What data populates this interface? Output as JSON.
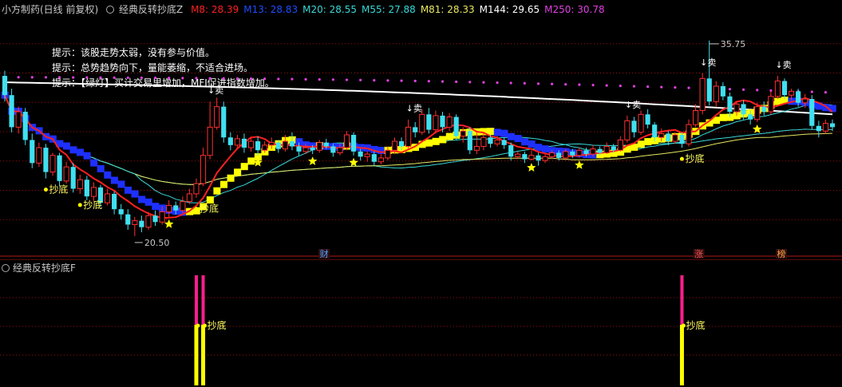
{
  "header": {
    "stock_name": "小方制药(日线 前复权)",
    "indicator_name": "经典反转抄底Z",
    "ma_labels": [
      {
        "text": "M8: 28.39",
        "color": "#ff2020"
      },
      {
        "text": "M13: 28.83",
        "color": "#1e4cff"
      },
      {
        "text": "M20: 28.55",
        "color": "#38d8d8"
      },
      {
        "text": "M55: 27.88",
        "color": "#38d8d8"
      },
      {
        "text": "M81: 28.33",
        "color": "#e8e860"
      },
      {
        "text": "M144: 29.65",
        "color": "#ffffff"
      },
      {
        "text": "M250: 30.78",
        "color": "#e040e0"
      }
    ]
  },
  "tips": [
    "提示：该股走势太弱，没有参与价值。",
    "提示：总势趋势向下，量能萎缩，不适合进场。",
    "提示：【绿灯】买计交易里增加，MFI促进指数增加。"
  ],
  "sub_header": {
    "indicator_name": "经典反转抄底F"
  },
  "colors": {
    "up": "#ff3030",
    "down": "#40e0f0",
    "m8": "#ff2020",
    "m20": "#38d8d8",
    "m81": "#e8e860",
    "m144": "#ffffff",
    "m250": "#e040e0",
    "band_yellow": "#ffff00",
    "band_blue": "#1e30ff",
    "label": "#ffff60",
    "bar_magenta": "#ff1e8c",
    "bar_yellow": "#ffff00",
    "grid": "#a01010",
    "axis": "#b01818"
  },
  "chart_data": {
    "type": "candlestick",
    "price_range": [
      19.5,
      37.8
    ],
    "max_price": {
      "label": "35.75"
    },
    "min_price": {
      "label": "20.50"
    },
    "signals": {
      "buy_label": "抄底",
      "sell_label": "卖",
      "sub_buy_label": "抄底"
    },
    "markers": [
      {
        "label": "财",
        "color": "#4aa0ff"
      },
      {
        "label": "涨",
        "color": "#ff5050"
      },
      {
        "label": "榜",
        "color": "#ffa040"
      }
    ],
    "candles": [
      [
        33.0,
        31.5,
        33.4,
        31.0
      ],
      [
        31.5,
        29.0,
        32.0,
        28.6
      ],
      [
        29.0,
        30.2,
        30.6,
        28.5
      ],
      [
        30.2,
        28.0,
        30.5,
        27.6
      ],
      [
        28.0,
        26.2,
        28.5,
        25.8
      ],
      [
        26.2,
        27.4,
        27.8,
        25.9
      ],
      [
        27.4,
        25.5,
        27.7,
        25.0
      ],
      [
        25.5,
        26.8,
        27.0,
        25.2
      ],
      [
        26.8,
        24.8,
        27.0,
        24.4
      ],
      [
        24.8,
        25.9,
        26.3,
        24.6
      ],
      [
        25.9,
        24.2,
        26.2,
        23.9
      ],
      [
        24.2,
        24.9,
        25.3,
        23.8
      ],
      [
        24.9,
        23.6,
        25.2,
        23.3
      ],
      [
        23.6,
        24.3,
        24.7,
        23.2
      ],
      [
        24.3,
        23.1,
        24.5,
        22.8
      ],
      [
        23.1,
        23.8,
        24.2,
        22.9
      ],
      [
        23.8,
        22.6,
        24.0,
        22.2
      ],
      [
        22.6,
        22.2,
        23.0,
        21.8
      ],
      [
        22.2,
        21.4,
        22.6,
        21.0
      ],
      [
        21.4,
        21.7,
        22.0,
        20.5
      ],
      [
        21.7,
        21.2,
        22.1,
        20.8
      ],
      [
        21.2,
        22.1,
        22.4,
        21.0
      ],
      [
        22.1,
        21.6,
        22.5,
        21.3
      ],
      [
        21.6,
        22.4,
        22.8,
        21.4
      ],
      [
        22.4,
        22.9,
        23.3,
        22.0
      ],
      [
        22.9,
        22.5,
        23.2,
        22.2
      ],
      [
        22.5,
        23.2,
        23.6,
        22.3
      ],
      [
        23.2,
        23.8,
        24.2,
        23.0
      ],
      [
        23.8,
        24.6,
        25.0,
        23.5
      ],
      [
        24.6,
        26.8,
        27.4,
        24.4
      ],
      [
        26.8,
        29.0,
        31.0,
        26.5
      ],
      [
        29.0,
        30.6,
        31.3,
        28.8
      ],
      [
        30.6,
        28.2,
        31.0,
        27.8
      ],
      [
        28.2,
        27.6,
        28.6,
        27.2
      ],
      [
        27.6,
        28.1,
        28.4,
        27.3
      ],
      [
        28.1,
        27.4,
        28.5,
        27.0
      ],
      [
        27.4,
        27.9,
        28.2,
        27.1
      ],
      [
        27.9,
        27.2,
        28.3,
        26.8
      ],
      [
        27.2,
        27.6,
        27.9,
        27.0
      ],
      [
        27.6,
        27.8,
        28.2,
        27.3
      ],
      [
        27.8,
        27.3,
        28.0,
        27.0
      ],
      [
        27.3,
        27.9,
        28.4,
        27.1
      ],
      [
        27.9,
        27.5,
        28.6,
        27.2
      ],
      [
        27.5,
        27.1,
        27.8,
        26.8
      ],
      [
        27.1,
        27.4,
        27.7,
        26.9
      ],
      [
        27.4,
        27.2,
        27.6,
        26.9
      ],
      [
        27.2,
        27.8,
        28.0,
        27.0
      ],
      [
        27.8,
        27.5,
        28.1,
        27.3
      ],
      [
        27.5,
        27.0,
        27.7,
        26.7
      ],
      [
        27.0,
        27.4,
        27.7,
        26.8
      ],
      [
        27.4,
        28.4,
        28.7,
        27.2
      ],
      [
        28.4,
        27.1,
        28.6,
        26.8
      ],
      [
        27.1,
        26.7,
        27.3,
        26.4
      ],
      [
        26.7,
        26.9,
        27.1,
        26.3
      ],
      [
        26.9,
        26.3,
        27.1,
        26.0
      ],
      [
        26.3,
        26.6,
        26.9,
        26.1
      ],
      [
        26.6,
        27.2,
        27.5,
        26.4
      ],
      [
        27.2,
        27.9,
        28.2,
        26.9
      ],
      [
        27.9,
        27.5,
        28.2,
        27.2
      ],
      [
        27.5,
        29.0,
        29.6,
        27.3
      ],
      [
        29.0,
        28.6,
        29.4,
        28.2
      ],
      [
        28.6,
        30.0,
        30.4,
        28.4
      ],
      [
        30.0,
        28.8,
        30.5,
        28.5
      ],
      [
        28.8,
        29.9,
        30.3,
        28.5
      ],
      [
        29.9,
        29.0,
        30.2,
        28.6
      ],
      [
        29.0,
        29.8,
        30.1,
        28.7
      ],
      [
        29.8,
        28.3,
        30.0,
        28.0
      ],
      [
        28.3,
        28.7,
        29.0,
        27.8
      ],
      [
        28.7,
        27.2,
        29.0,
        26.9
      ],
      [
        27.2,
        27.5,
        28.6,
        26.9
      ],
      [
        27.5,
        28.2,
        28.5,
        27.2
      ],
      [
        28.2,
        27.7,
        28.4,
        27.4
      ],
      [
        27.7,
        28.0,
        28.3,
        27.5
      ],
      [
        28.0,
        27.6,
        28.2,
        27.3
      ],
      [
        27.6,
        26.7,
        27.8,
        26.4
      ],
      [
        26.7,
        26.9,
        27.1,
        26.5
      ],
      [
        26.9,
        26.5,
        27.1,
        26.2
      ],
      [
        26.5,
        26.8,
        27.2,
        26.4
      ],
      [
        26.8,
        26.4,
        27.0,
        26.0
      ],
      [
        26.4,
        26.7,
        26.9,
        26.2
      ],
      [
        26.7,
        27.0,
        27.2,
        26.5
      ],
      [
        27.0,
        26.6,
        27.2,
        26.4
      ],
      [
        26.6,
        27.1,
        27.3,
        26.4
      ],
      [
        27.1,
        26.8,
        27.3,
        26.6
      ],
      [
        26.8,
        27.2,
        27.4,
        26.6
      ],
      [
        27.2,
        26.9,
        27.4,
        26.7
      ],
      [
        26.9,
        27.3,
        27.6,
        26.7
      ],
      [
        27.3,
        27.0,
        27.5,
        26.8
      ],
      [
        27.0,
        27.5,
        27.8,
        26.9
      ],
      [
        27.5,
        27.2,
        27.7,
        27.0
      ],
      [
        27.2,
        28.0,
        28.3,
        27.1
      ],
      [
        28.0,
        29.5,
        29.9,
        27.8
      ],
      [
        29.5,
        28.6,
        29.8,
        28.2
      ],
      [
        28.6,
        30.0,
        30.3,
        28.4
      ],
      [
        30.0,
        29.2,
        30.4,
        28.9
      ],
      [
        29.2,
        28.2,
        29.4,
        27.9
      ],
      [
        28.2,
        28.5,
        28.9,
        27.9
      ],
      [
        28.5,
        27.9,
        28.7,
        27.6
      ],
      [
        27.9,
        28.4,
        28.6,
        27.7
      ],
      [
        28.4,
        27.7,
        28.6,
        27.4
      ],
      [
        27.7,
        29.2,
        29.6,
        27.5
      ],
      [
        29.2,
        30.3,
        30.8,
        29.0
      ],
      [
        30.3,
        32.8,
        33.2,
        30.0
      ],
      [
        32.8,
        31.0,
        35.75,
        30.7
      ],
      [
        31.0,
        32.2,
        32.6,
        30.6
      ],
      [
        32.2,
        31.4,
        32.5,
        31.1
      ],
      [
        31.4,
        30.2,
        31.7,
        29.8
      ],
      [
        30.2,
        30.8,
        31.0,
        29.9
      ],
      [
        30.8,
        30.0,
        31.1,
        29.6
      ],
      [
        30.0,
        29.6,
        30.3,
        29.2
      ],
      [
        29.6,
        30.6,
        30.9,
        29.4
      ],
      [
        30.6,
        30.2,
        31.0,
        29.9
      ],
      [
        30.2,
        31.4,
        31.8,
        30.0
      ],
      [
        31.4,
        32.6,
        33.0,
        31.2
      ],
      [
        32.6,
        31.5,
        32.8,
        31.2
      ],
      [
        31.5,
        31.8,
        32.0,
        31.1
      ],
      [
        31.8,
        30.9,
        32.0,
        30.6
      ],
      [
        30.9,
        31.2,
        31.6,
        30.5
      ],
      [
        31.2,
        29.1,
        31.5,
        28.8
      ],
      [
        29.1,
        28.7,
        29.5,
        28.2
      ],
      [
        28.7,
        29.3,
        29.6,
        28.5
      ],
      [
        29.3,
        29.0,
        29.6,
        28.7
      ]
    ],
    "candle_signals": [
      {
        "candle": 6,
        "type": "buy",
        "label_index": 0
      },
      {
        "candle": 11,
        "type": "buy"
      },
      {
        "candle": 28,
        "type": "buy"
      },
      {
        "candle": 30,
        "type": "sell"
      },
      {
        "candle": 59,
        "type": "sell"
      },
      {
        "candle": 91,
        "type": "sell"
      },
      {
        "candle": 102,
        "type": "sell"
      },
      {
        "candle": 113,
        "type": "sell"
      },
      {
        "candle": 99,
        "type": "buy"
      }
    ],
    "stars": [
      24,
      37,
      45,
      51,
      77,
      84,
      110
    ],
    "sub_bars": [
      {
        "candle": 28,
        "magenta": 1.0,
        "yellow": 0.55
      },
      {
        "candle": 29,
        "magenta": 1.0,
        "yellow": 0.55
      },
      {
        "candle": 99,
        "magenta": 1.0,
        "yellow": 0.55
      }
    ]
  }
}
